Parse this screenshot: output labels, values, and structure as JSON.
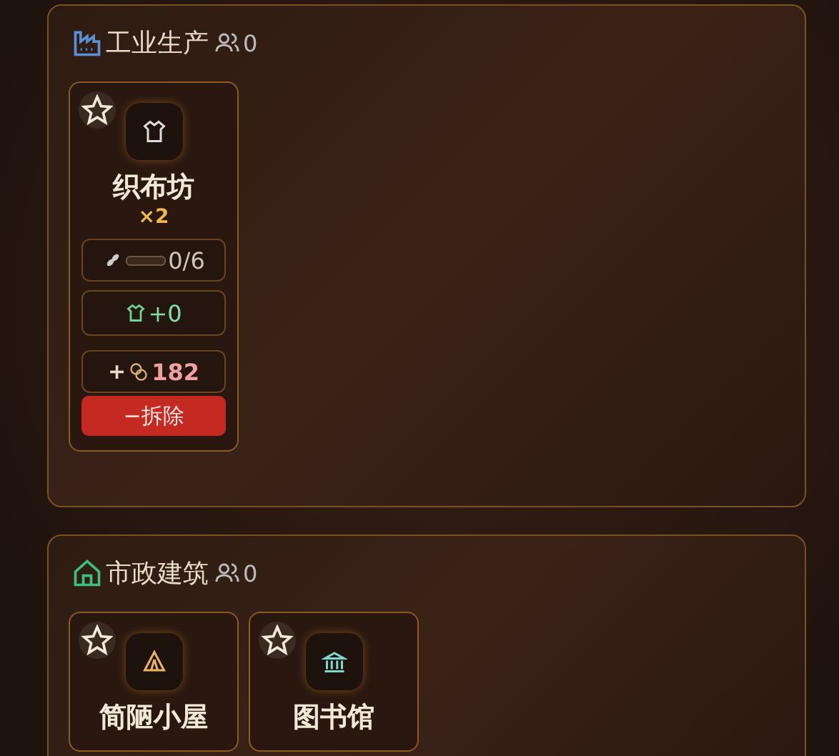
{
  "sections": [
    {
      "title": "工业生产",
      "kind": "factory",
      "workers": "0",
      "buildings": [
        {
          "name": "织布坊",
          "kind": "shirt",
          "count": "×2",
          "favorite": false,
          "stats": [
            {
              "kind": "storage",
              "value": "0/6",
              "level": 0
            },
            {
              "kind": "output",
              "value": "+0"
            },
            {
              "kind": "income",
              "prefix": "+",
              "value": "182"
            }
          ],
          "action": "−拆除"
        }
      ]
    },
    {
      "title": "市政建筑",
      "kind": "house",
      "workers": "0",
      "buildings": [
        {
          "name": "简陋小屋",
          "kind": "tent",
          "favorite": false
        },
        {
          "name": "图书馆",
          "kind": "temple",
          "favorite": false
        }
      ]
    }
  ]
}
